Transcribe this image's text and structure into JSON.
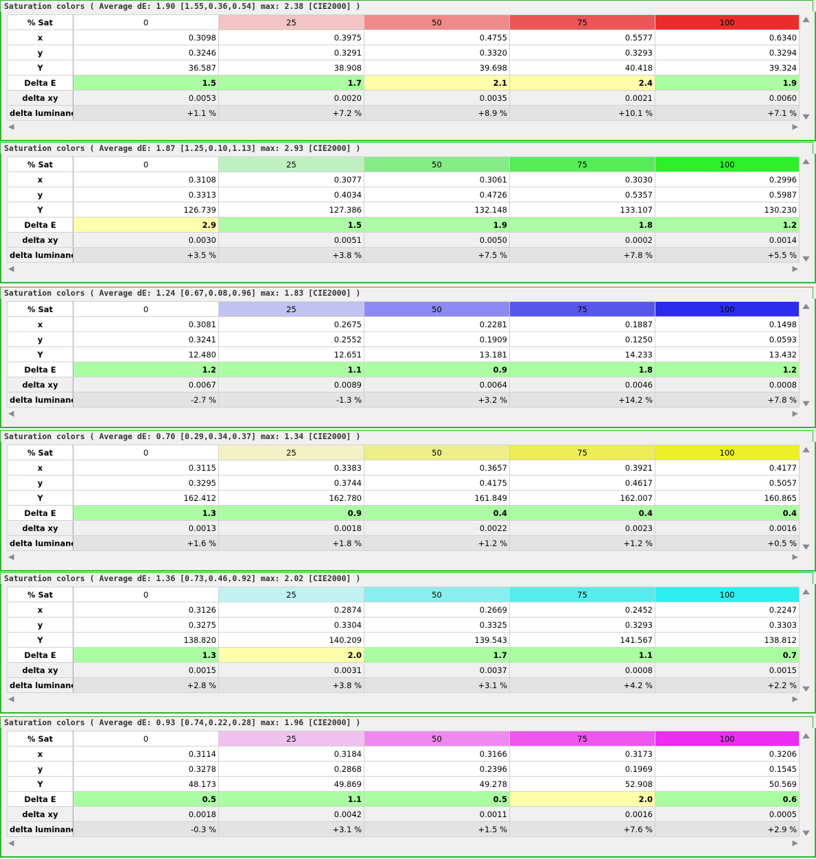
{
  "row_labels": [
    "% Sat",
    "x",
    "y",
    "Y",
    "Delta E",
    "delta xy",
    "delta luminance"
  ],
  "scroll_icons": {
    "up": "▲",
    "down": "▼",
    "left": "◀",
    "right": "▶"
  },
  "panels": [
    {
      "title": "Saturation colors ( Average dE: 1.90 [1.55,0.36,0.54] max: 2.38 [CIE2000] )",
      "sat": [
        "0",
        "25",
        "50",
        "75",
        "100"
      ],
      "header_colors": [
        "#ffffff",
        "#f2c4c4",
        "#f08b8b",
        "#ec5656",
        "#ec2c2c"
      ],
      "x": [
        "0.3098",
        "0.3975",
        "0.4755",
        "0.5577",
        "0.6340"
      ],
      "y": [
        "0.3246",
        "0.3291",
        "0.3320",
        "0.3293",
        "0.3294"
      ],
      "Y": [
        "36.587",
        "38.908",
        "39.698",
        "40.418",
        "39.324"
      ],
      "delta_e": [
        "1.5",
        "1.7",
        "2.1",
        "2.4",
        "1.9"
      ],
      "delta_e_colors": [
        "#acfca4",
        "#acfca4",
        "#fefeac",
        "#fefeac",
        "#acfca4"
      ],
      "delta_xy": [
        "0.0053",
        "0.0020",
        "0.0035",
        "0.0021",
        "0.0060"
      ],
      "delta_lum": [
        "+1.1 %",
        "+7.2 %",
        "+8.9 %",
        "+10.1 %",
        "+7.1 %"
      ]
    },
    {
      "title": "Saturation colors ( Average dE: 1.87 [1.25,0.10,1.13] max: 2.93 [CIE2000] )",
      "sat": [
        "0",
        "25",
        "50",
        "75",
        "100"
      ],
      "header_colors": [
        "#ffffff",
        "#bff0c1",
        "#86ec88",
        "#57ec57",
        "#2cf02c"
      ],
      "x": [
        "0.3108",
        "0.3077",
        "0.3061",
        "0.3030",
        "0.2996"
      ],
      "y": [
        "0.3313",
        "0.4034",
        "0.4726",
        "0.5357",
        "0.5987"
      ],
      "Y": [
        "126.739",
        "127.386",
        "132.148",
        "133.107",
        "130.230"
      ],
      "delta_e": [
        "2.9",
        "1.5",
        "1.9",
        "1.8",
        "1.2"
      ],
      "delta_e_colors": [
        "#fefeac",
        "#acfca4",
        "#acfca4",
        "#acfca4",
        "#acfca4"
      ],
      "delta_xy": [
        "0.0030",
        "0.0051",
        "0.0050",
        "0.0002",
        "0.0014"
      ],
      "delta_lum": [
        "+3.5 %",
        "+3.8 %",
        "+7.5 %",
        "+7.8 %",
        "+5.5 %"
      ]
    },
    {
      "title": "Saturation colors ( Average dE: 1.24 [0.67,0.08,0.96] max: 1.83 [CIE2000] )",
      "sat": [
        "0",
        "25",
        "50",
        "75",
        "100"
      ],
      "header_colors": [
        "#ffffff",
        "#c2c2f2",
        "#8a8af0",
        "#5757ec",
        "#2c2cec"
      ],
      "x": [
        "0.3081",
        "0.2675",
        "0.2281",
        "0.1887",
        "0.1498"
      ],
      "y": [
        "0.3241",
        "0.2552",
        "0.1909",
        "0.1250",
        "0.0593"
      ],
      "Y": [
        "12.480",
        "12.651",
        "13.181",
        "14.233",
        "13.432"
      ],
      "delta_e": [
        "1.2",
        "1.1",
        "0.9",
        "1.8",
        "1.2"
      ],
      "delta_e_colors": [
        "#acfca4",
        "#acfca4",
        "#acfca4",
        "#acfca4",
        "#acfca4"
      ],
      "delta_xy": [
        "0.0067",
        "0.0089",
        "0.0064",
        "0.0046",
        "0.0008"
      ],
      "delta_lum": [
        "-2.7 %",
        "-1.3 %",
        "+3.2 %",
        "+14.2 %",
        "+7.8 %"
      ]
    },
    {
      "title": "Saturation colors ( Average dE: 0.70 [0.29,0.34,0.37] max: 1.34 [CIE2000] )",
      "sat": [
        "0",
        "25",
        "50",
        "75",
        "100"
      ],
      "header_colors": [
        "#ffffff",
        "#f2f2c4",
        "#eeee8a",
        "#ecec56",
        "#ecf02c"
      ],
      "x": [
        "0.3115",
        "0.3383",
        "0.3657",
        "0.3921",
        "0.4177"
      ],
      "y": [
        "0.3295",
        "0.3744",
        "0.4175",
        "0.4617",
        "0.5057"
      ],
      "Y": [
        "162.412",
        "162.780",
        "161.849",
        "162.007",
        "160.865"
      ],
      "delta_e": [
        "1.3",
        "0.9",
        "0.4",
        "0.4",
        "0.4"
      ],
      "delta_e_colors": [
        "#acfca4",
        "#acfca4",
        "#acfca4",
        "#acfca4",
        "#acfca4"
      ],
      "delta_xy": [
        "0.0013",
        "0.0018",
        "0.0022",
        "0.0023",
        "0.0016"
      ],
      "delta_lum": [
        "+1.6 %",
        "+1.8 %",
        "+1.2 %",
        "+1.2 %",
        "+0.5 %"
      ]
    },
    {
      "title": "Saturation colors ( Average dE: 1.36 [0.73,0.46,0.92] max: 2.02 [CIE2000] )",
      "sat": [
        "0",
        "25",
        "50",
        "75",
        "100"
      ],
      "header_colors": [
        "#ffffff",
        "#c2f2f2",
        "#8aeeee",
        "#56ecec",
        "#2cf0f0"
      ],
      "x": [
        "0.3126",
        "0.2874",
        "0.2669",
        "0.2452",
        "0.2247"
      ],
      "y": [
        "0.3275",
        "0.3304",
        "0.3325",
        "0.3293",
        "0.3303"
      ],
      "Y": [
        "138.820",
        "140.209",
        "139.543",
        "141.567",
        "138.812"
      ],
      "delta_e": [
        "1.3",
        "2.0",
        "1.7",
        "1.1",
        "0.7"
      ],
      "delta_e_colors": [
        "#acfca4",
        "#fefeac",
        "#acfca4",
        "#acfca4",
        "#acfca4"
      ],
      "delta_xy": [
        "0.0015",
        "0.0031",
        "0.0037",
        "0.0008",
        "0.0015"
      ],
      "delta_lum": [
        "+2.8 %",
        "+3.8 %",
        "+3.1 %",
        "+4.2 %",
        "+2.2 %"
      ]
    },
    {
      "title": "Saturation colors ( Average dE: 0.93 [0.74,0.22,0.28] max: 1.96 [CIE2000] )",
      "sat": [
        "0",
        "25",
        "50",
        "75",
        "100"
      ],
      "header_colors": [
        "#ffffff",
        "#f0c2f0",
        "#ee8aee",
        "#ec56ec",
        "#ec2cf0"
      ],
      "x": [
        "0.3114",
        "0.3184",
        "0.3166",
        "0.3173",
        "0.3206"
      ],
      "y": [
        "0.3278",
        "0.2868",
        "0.2396",
        "0.1969",
        "0.1545"
      ],
      "Y": [
        "48.173",
        "49.869",
        "49.278",
        "52.908",
        "50.569"
      ],
      "delta_e": [
        "0.5",
        "1.1",
        "0.5",
        "2.0",
        "0.6"
      ],
      "delta_e_colors": [
        "#acfca4",
        "#acfca4",
        "#acfca4",
        "#fefeac",
        "#acfca4"
      ],
      "delta_xy": [
        "0.0018",
        "0.0042",
        "0.0011",
        "0.0016",
        "0.0005"
      ],
      "delta_lum": [
        "-0.3 %",
        "+3.1 %",
        "+1.5 %",
        "+7.6 %",
        "+2.9 %"
      ]
    }
  ]
}
